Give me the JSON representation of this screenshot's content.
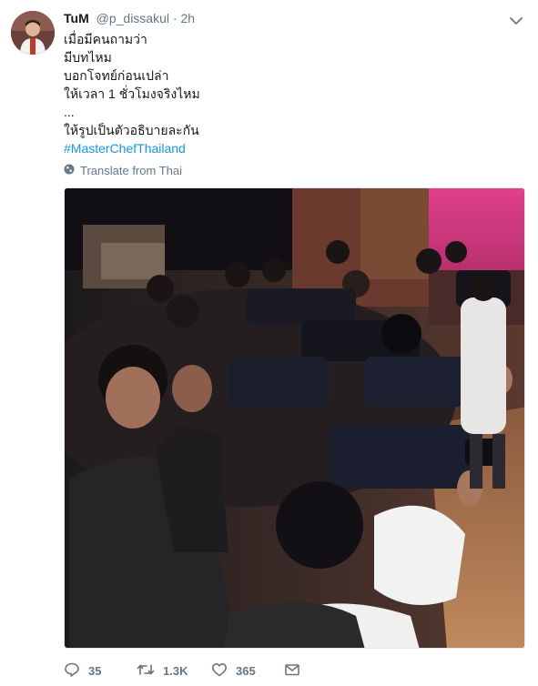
{
  "tweet": {
    "display_name": "TuM",
    "handle": "@p_dissakul",
    "separator": "·",
    "time": "2h",
    "lines": [
      "เมื่อมีคนถามว่า",
      "มีบทไหม",
      "บอกโจทย์ก่อนเปล่า",
      "ให้เวลา 1 ชั่วโมงจริงไหม",
      "...",
      "ให้รูปเป็นตัวอธิบายละกัน"
    ],
    "hashtag": "#MasterChefThailand",
    "translate_label": "Translate from Thai"
  },
  "actions": {
    "replies": "35",
    "retweets": "1.3K",
    "likes": "365"
  },
  "colors": {
    "link": "#1b95e0",
    "secondary_text": "#657786",
    "primary_text": "#14171a"
  },
  "icons": [
    "chevron-down-icon",
    "globe-icon",
    "reply-icon",
    "retweet-icon",
    "heart-icon",
    "envelope-icon"
  ]
}
